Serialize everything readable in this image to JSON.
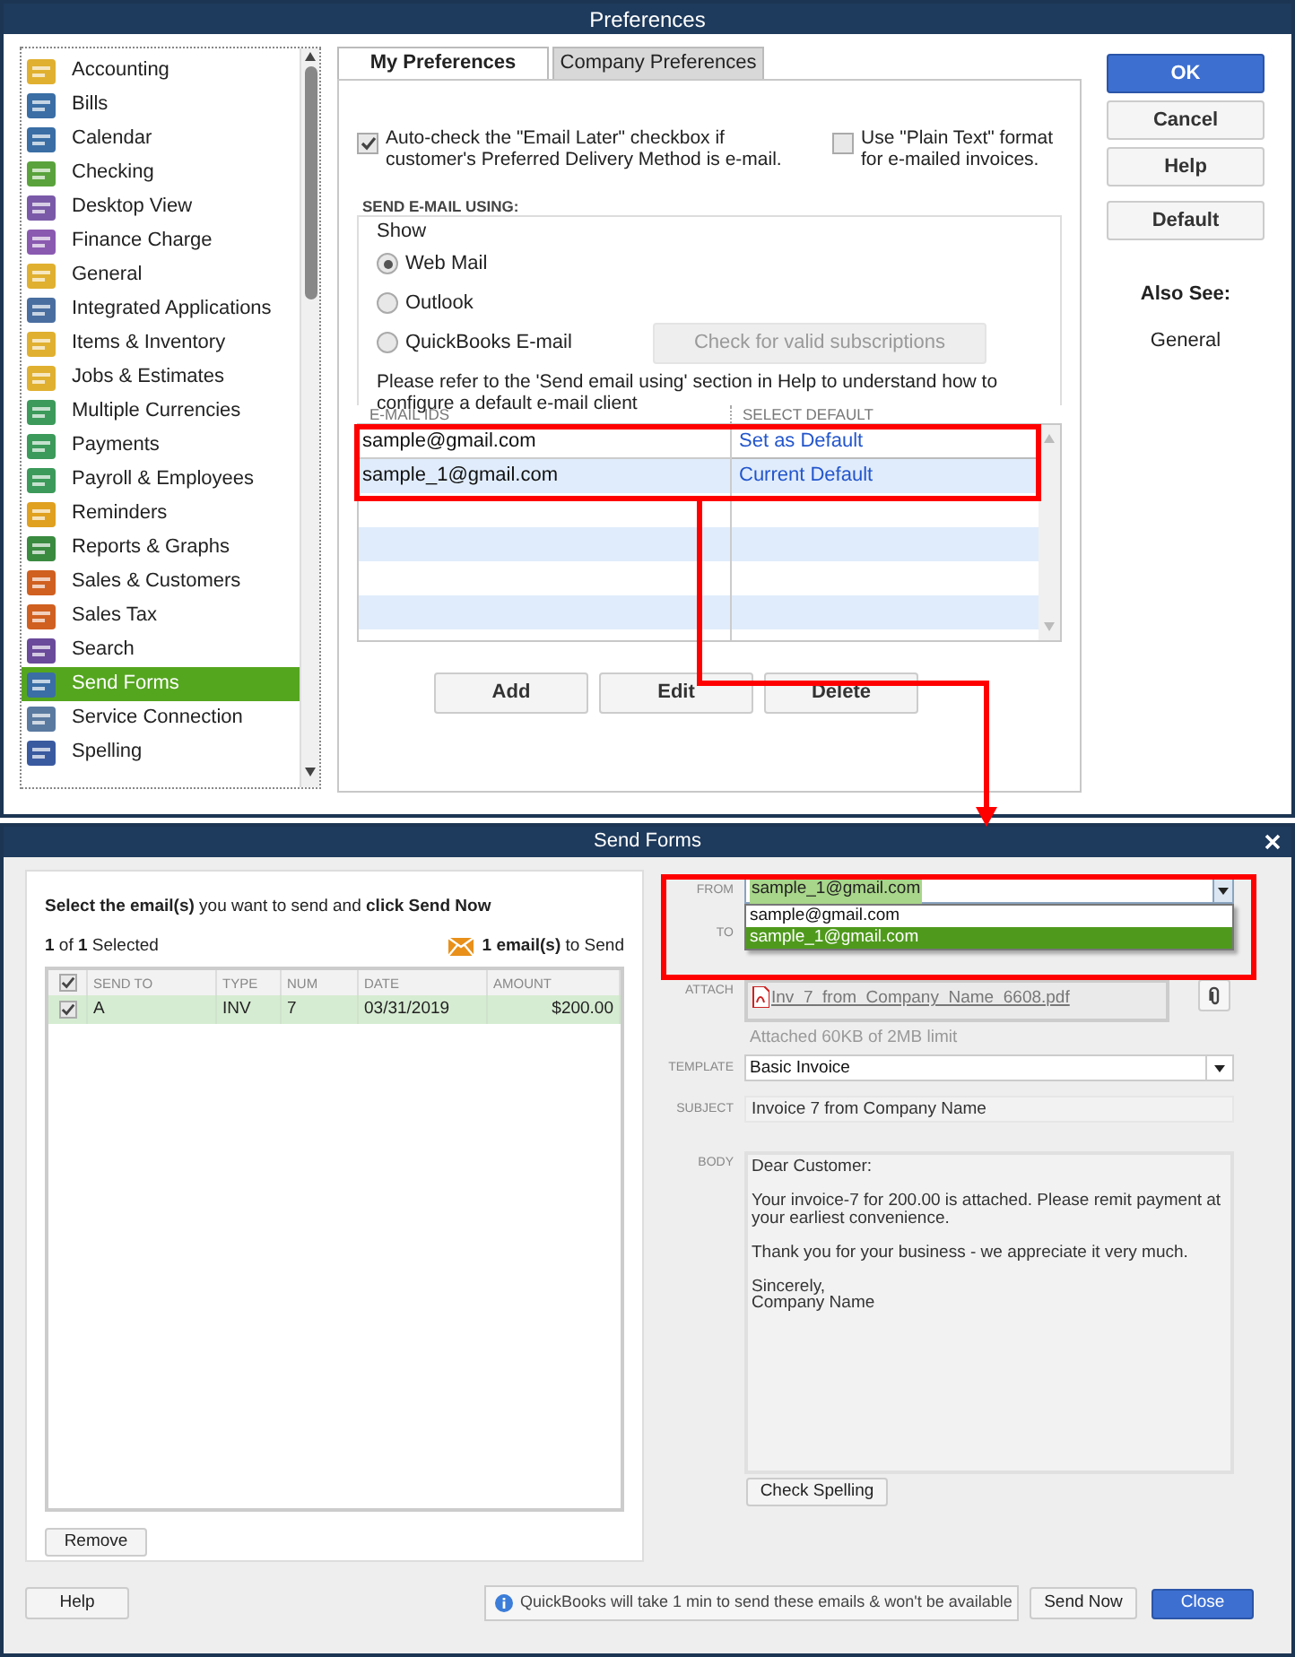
{
  "preferences": {
    "title": "Preferences",
    "categories": [
      {
        "label": "Accounting",
        "selected": false
      },
      {
        "label": "Bills",
        "selected": false
      },
      {
        "label": "Calendar",
        "selected": false
      },
      {
        "label": "Checking",
        "selected": false
      },
      {
        "label": "Desktop View",
        "selected": false
      },
      {
        "label": "Finance Charge",
        "selected": false
      },
      {
        "label": "General",
        "selected": false
      },
      {
        "label": "Integrated Applications",
        "selected": false
      },
      {
        "label": "Items & Inventory",
        "selected": false
      },
      {
        "label": "Jobs & Estimates",
        "selected": false
      },
      {
        "label": "Multiple Currencies",
        "selected": false
      },
      {
        "label": "Payments",
        "selected": false
      },
      {
        "label": "Payroll & Employees",
        "selected": false
      },
      {
        "label": "Reminders",
        "selected": false
      },
      {
        "label": "Reports & Graphs",
        "selected": false
      },
      {
        "label": "Sales & Customers",
        "selected": false
      },
      {
        "label": "Sales Tax",
        "selected": false
      },
      {
        "label": "Search",
        "selected": false
      },
      {
        "label": "Send Forms",
        "selected": true
      },
      {
        "label": "Service Connection",
        "selected": false
      },
      {
        "label": "Spelling",
        "selected": false
      }
    ],
    "tabs": [
      {
        "label": "My Preferences",
        "selected": true
      },
      {
        "label": "Company Preferences",
        "selected": false
      }
    ],
    "options": [
      {
        "label": "Auto-check the \"Email Later\" checkbox if customer's Preferred Delivery Method is e-mail.",
        "checked": true
      },
      {
        "label": "Use \"Plain Text\" format for e-mailed invoices.",
        "checked": false
      }
    ],
    "send_using": {
      "title": "SEND E-MAIL USING:",
      "show_label": "Show",
      "clients": [
        {
          "label": "Web Mail",
          "selected": true
        },
        {
          "label": "Outlook",
          "selected": false
        },
        {
          "label": "QuickBooks E-mail",
          "selected": false
        }
      ],
      "check_button": "Check for valid subscriptions",
      "note": "Please refer to the 'Send email using' section in Help to understand how to configure a default e-mail client"
    },
    "email_table": {
      "columns": [
        "E-MAIL IDS",
        "SELECT DEFAULT"
      ],
      "rows": [
        {
          "email": "sample@gmail.com",
          "action": "Set as Default",
          "selected": false
        },
        {
          "email": "sample_1@gmail.com",
          "action": "Current Default",
          "selected": true
        }
      ]
    },
    "table_buttons": [
      "Add",
      "Edit",
      "Delete"
    ],
    "side_buttons": [
      {
        "label": "OK",
        "kind": "primary"
      },
      {
        "label": "Cancel",
        "kind": "normal"
      },
      {
        "label": "Help",
        "kind": "normal"
      },
      {
        "label": "Default",
        "kind": "normal"
      }
    ],
    "also_see": {
      "title": "Also See:",
      "link": "General"
    }
  },
  "send_forms": {
    "title": "Send Forms",
    "instruction": "**Select the email(s)** you want to send and **click Send Now**",
    "selected_count": "**1** of **1** Selected",
    "to_send": "**1 email(s)** to Send",
    "table": {
      "all_checked": true,
      "columns": [
        "SEND TO",
        "TYPE",
        "NUM",
        "DATE",
        "AMOUNT"
      ],
      "rows": [
        {
          "checked": true,
          "cells": [
            "A",
            "INV",
            "7",
            "03/31/2019",
            "$200.00"
          ]
        }
      ]
    },
    "remove_button": "Remove",
    "help_button": "Help",
    "from": {
      "label": "FROM",
      "value": "sample_1@gmail.com",
      "options": [
        {
          "label": "sample@gmail.com",
          "selected": false
        },
        {
          "label": "sample_1@gmail.com",
          "selected": true
        }
      ]
    },
    "to": {
      "label": "TO"
    },
    "attach": {
      "label": "ATTACH",
      "file": "Inv_7_from_Company_Name_6608.pdf",
      "note": "Attached 60KB of 2MB limit"
    },
    "template": {
      "label": "TEMPLATE",
      "value": "Basic Invoice"
    },
    "subject": {
      "label": "SUBJECT",
      "value": "Invoice 7 from Company Name"
    },
    "body": {
      "label": "BODY",
      "value": "Dear Customer:\n\nYour invoice-7 for 200.00 is attached. Please remit payment at your earliest convenience.\n\nThank you for your business - we appreciate it very much.\n\nSincerely,\nCompany Name"
    },
    "check_spelling": "Check Spelling",
    "info": "QuickBooks will take 1 min to send these emails & won't be available",
    "send_now": "Send Now",
    "close": "Close"
  }
}
